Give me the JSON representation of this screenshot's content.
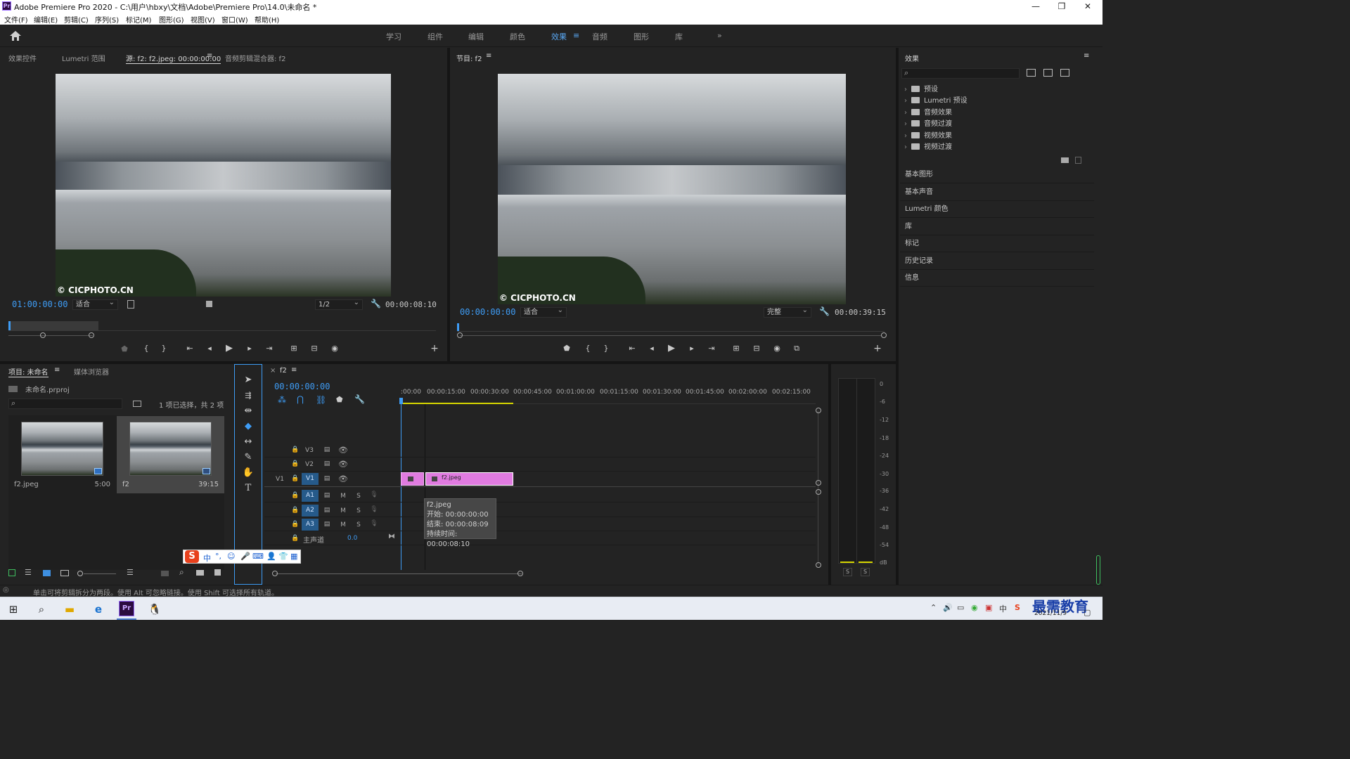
{
  "window": {
    "title": "Adobe Premiere Pro 2020 - C:\\用户\\hbxy\\文档\\Adobe\\Premiere Pro\\14.0\\未命名 *",
    "app_logo": "Pr",
    "min_glyph": "—",
    "max_glyph": "❐",
    "close_glyph": "✕"
  },
  "menu": [
    "文件(F)",
    "编辑(E)",
    "剪辑(C)",
    "序列(S)",
    "标记(M)",
    "图形(G)",
    "视图(V)",
    "窗口(W)",
    "帮助(H)"
  ],
  "workspaces": {
    "items": [
      "学习",
      "组件",
      "编辑",
      "颜色",
      "效果",
      "音频",
      "图形",
      "库"
    ],
    "active": "效果",
    "menu_glyph": "≡",
    "more_glyph": "»"
  },
  "source_panel": {
    "tabs": [
      "效果控件",
      "Lumetri 范围",
      "源: f2: f2.jpeg: 00:00:00:00",
      "音频剪辑混合器: f2"
    ],
    "menu_glyph": "≡",
    "timecode": "01:00:00:00",
    "fit": "适合",
    "resolution": "1/2",
    "duration": "00:00:08:10",
    "watermark": "© CICPHOTO.CN"
  },
  "program_panel": {
    "tab": "节目: f2",
    "menu_glyph": "≡",
    "timecode": "00:00:00:00",
    "fit": "适合",
    "quality": "完整",
    "duration": "00:00:39:15",
    "watermark": "© CICPHOTO.CN"
  },
  "effects_panel": {
    "title": "效果",
    "menu_glyph": "≡",
    "search_placeholder": "",
    "tree": [
      "预设",
      "Lumetri 预设",
      "音频效果",
      "音频过渡",
      "视频效果",
      "视频过渡"
    ],
    "sections": [
      "基本图形",
      "基本声音",
      "Lumetri 颜色",
      "库",
      "标记",
      "历史记录",
      "信息"
    ]
  },
  "project_panel": {
    "tabs": [
      "项目: 未命名",
      "媒体浏览器"
    ],
    "menu_glyph": "≡",
    "file": "未命名.prproj",
    "selection": "1 项已选择，共 2 项",
    "items": [
      {
        "name": "f2.jpeg",
        "duration": "5:00"
      },
      {
        "name": "f2",
        "duration": "39:15"
      }
    ]
  },
  "timeline": {
    "close_glyph": "×",
    "tab": "f2",
    "menu_glyph": "≡",
    "timecode": "00:00:00:00",
    "ruler": [
      ":00:00",
      "00:00:15:00",
      "00:00:30:00",
      "00:00:45:00",
      "00:01:00:00",
      "00:01:15:00",
      "00:01:30:00",
      "00:01:45:00",
      "00:02:00:00",
      "00:02:15:00"
    ],
    "video_tracks": [
      "V3",
      "V2",
      "V1"
    ],
    "audio_tracks": [
      "A1",
      "A2",
      "A3"
    ],
    "source_v1": "V1",
    "master_label": "主声道",
    "master_value": "0.0",
    "clip_name": "f2.jpeg",
    "tooltip": {
      "title": "f2.jpeg",
      "start": "开始: 00:00:00:00",
      "end": "结束: 00:00:08:09",
      "duration": "持续时间: 00:00:08:10"
    },
    "track_labels": {
      "m": "M",
      "s": "S"
    }
  },
  "vu_meter": {
    "scale": [
      "0",
      "-6",
      "-12",
      "-18",
      "-24",
      "-30",
      "-36",
      "-42",
      "-48",
      "-54",
      "dB"
    ],
    "solo": [
      "S",
      "S"
    ]
  },
  "status_bar": {
    "text": "单击可将剪辑拆分为两段。使用 Alt 可忽略链接。使用 Shift 可选择所有轨道。"
  },
  "ime_bar": {
    "logo": "S",
    "mode": "中",
    "punct": "°,"
  },
  "taskbar": {
    "clock_time": "2021/11/9",
    "brand_watermark": "最需教育"
  }
}
